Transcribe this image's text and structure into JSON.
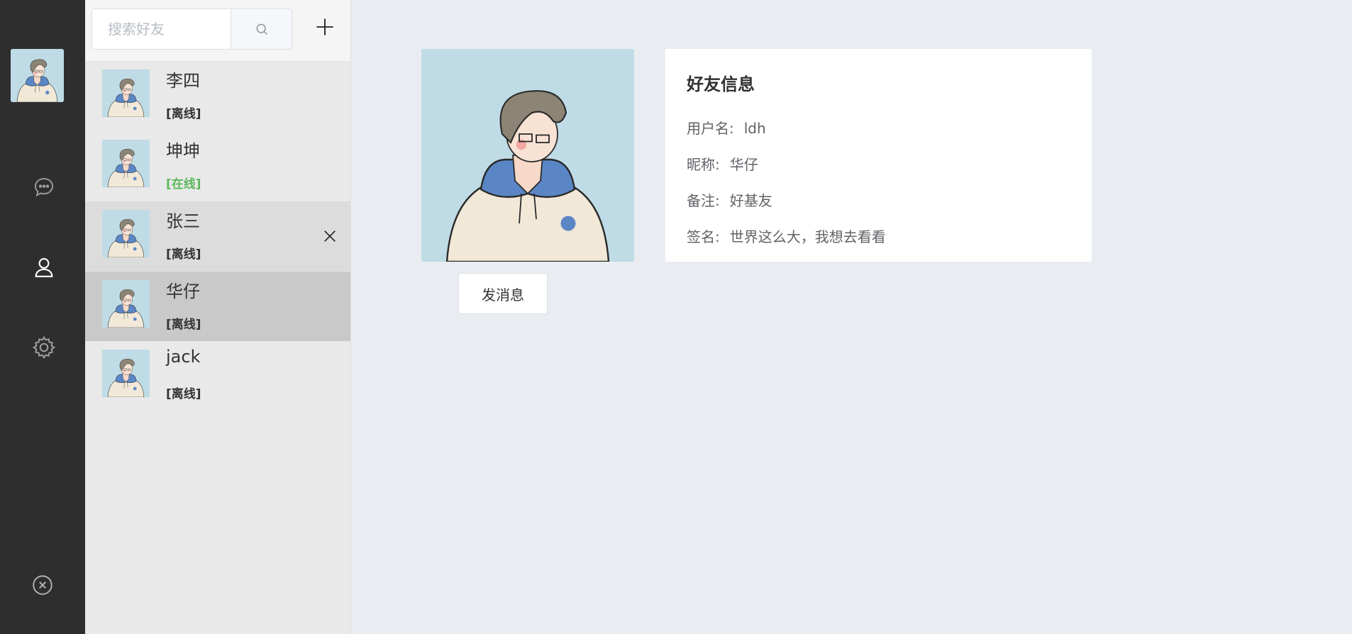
{
  "search": {
    "placeholder": "搜索好友"
  },
  "friends": [
    {
      "name": "李四",
      "status": "[离线]"
    },
    {
      "name": "坤坤",
      "status": "[在线]"
    },
    {
      "name": "张三",
      "status": "[离线]"
    },
    {
      "name": "华仔",
      "status": "[离线]"
    },
    {
      "name": "jack",
      "status": "[离线]"
    }
  ],
  "detail": {
    "title": "好友信息",
    "username_label": "用户名:",
    "username": "ldh",
    "nickname_label": "昵称:",
    "nickname": "华仔",
    "remark_label": "备注:",
    "remark": "好基友",
    "signature_label": "签名:",
    "signature": "世界这么大，我想去看看",
    "send_button": "发消息"
  },
  "icons": [
    "chat-icon",
    "user-icon",
    "settings-icon",
    "close-circle-icon",
    "search-icon",
    "plus-icon",
    "close-icon"
  ],
  "colors": {
    "rail": "#2e2e2e",
    "online": "#5cb85c",
    "background": "#e9edf1"
  }
}
